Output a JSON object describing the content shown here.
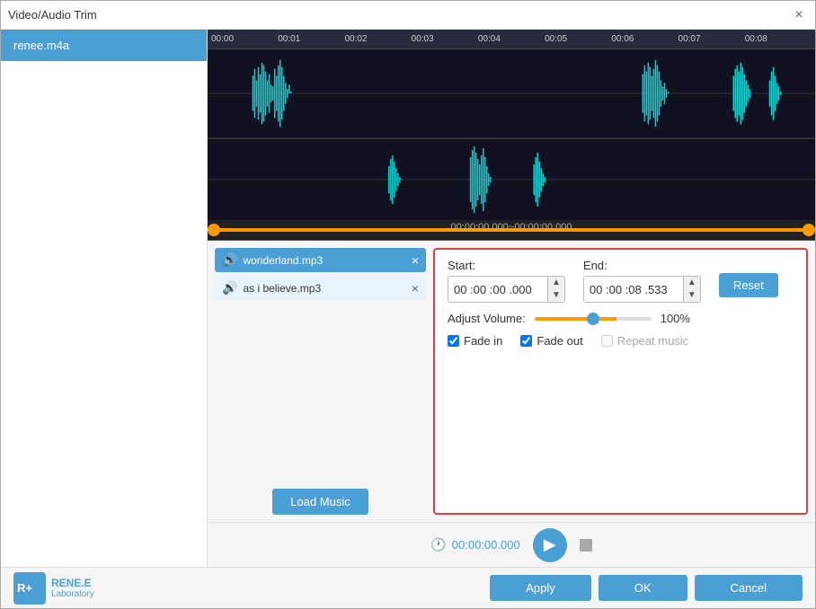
{
  "window": {
    "title": "Video/Audio Trim",
    "close_label": "×"
  },
  "sidebar": {
    "items": [
      {
        "label": "renee.m4a",
        "active": true
      }
    ]
  },
  "timeline": {
    "marks": [
      "00:00",
      "00:01",
      "00:02",
      "00:03",
      "00:04",
      "00:05",
      "00:06",
      "00:07",
      "00:08"
    ]
  },
  "trim_label": "00:00:00.000~00:00:00.000",
  "music_list": {
    "item1": "wonderland.mp3",
    "item2": "as i believe.mp3",
    "load_btn": "Load Music"
  },
  "settings": {
    "start_label": "Start:",
    "end_label": "End:",
    "start_value": "00 :00 :00 .000",
    "end_value": "00 :00 :08 .533",
    "reset_btn": "Reset",
    "volume_label": "Adjust Volume:",
    "volume_pct": "100%",
    "fade_in_label": "Fade in",
    "fade_out_label": "Fade out",
    "repeat_label": "Repeat music"
  },
  "playback": {
    "time": "00:00:00.000"
  },
  "footer": {
    "apply_btn": "Apply",
    "ok_btn": "OK",
    "cancel_btn": "Cancel"
  },
  "brand": {
    "name": "RENE.E",
    "sub": "Laboratory"
  }
}
